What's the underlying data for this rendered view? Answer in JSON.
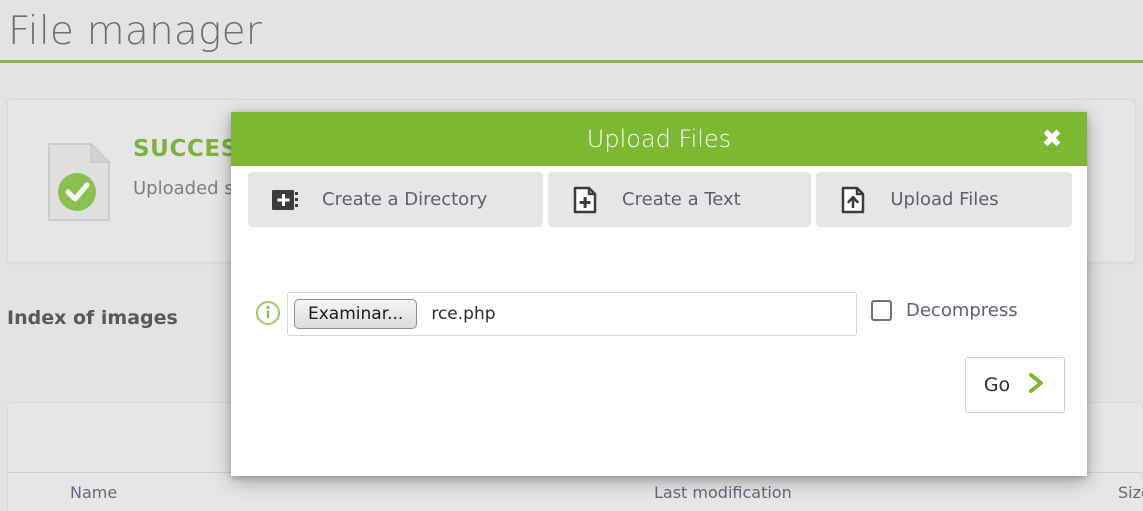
{
  "header": {
    "title": "File manager",
    "accent_color": "#86b355"
  },
  "alert": {
    "icon": "document-check-icon",
    "title": "SUCCESS",
    "message": "Uploaded su",
    "title_color": "#7fb13f"
  },
  "index": {
    "heading": "Index of images"
  },
  "table": {
    "columns": [
      {
        "label": "Name"
      },
      {
        "label": "Last modification"
      },
      {
        "label": "Size"
      }
    ]
  },
  "modal": {
    "title": "Upload Files",
    "header_color": "#7db832",
    "close_icon": "close-icon",
    "close_label": "✖",
    "tabs": [
      {
        "label": "Create a Directory",
        "icon": "folder-plus-icon"
      },
      {
        "label": "Create a Text",
        "icon": "file-plus-icon"
      },
      {
        "label": "Upload Files",
        "icon": "file-upload-icon"
      }
    ],
    "file_row": {
      "info_icon": "info-circle-icon",
      "browse_label": "Examinar...",
      "file_name": "rce.php",
      "decompress_label": "Decompress",
      "decompress_checked": false
    },
    "go": {
      "label": "Go",
      "icon": "chevron-right-icon",
      "icon_color": "#7db832"
    }
  }
}
